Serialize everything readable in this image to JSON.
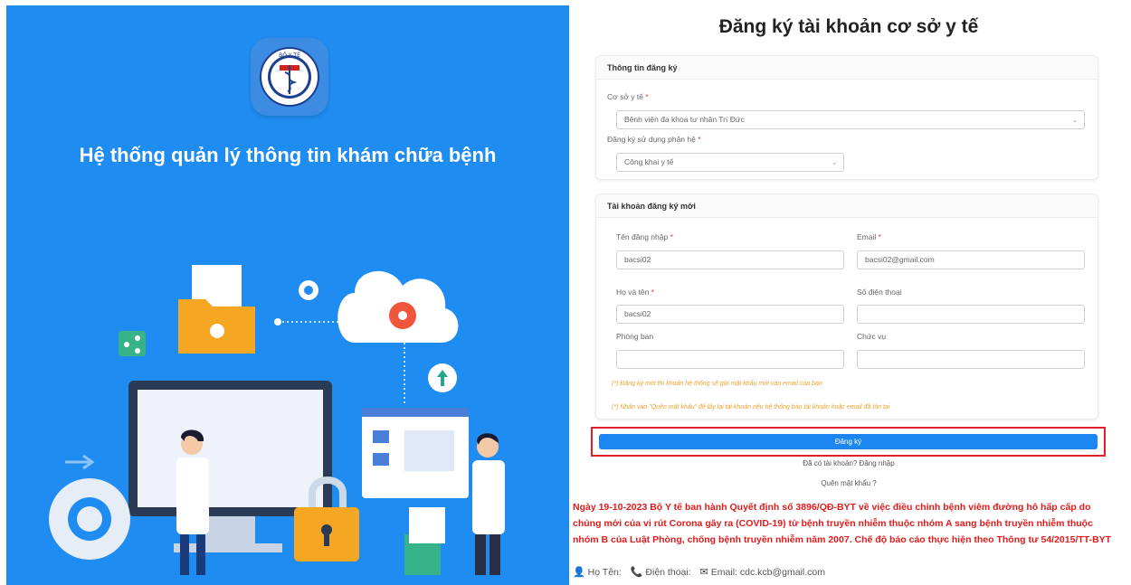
{
  "left_panel": {
    "headline": "Hệ thống quản lý thông tin khám chữa bệnh",
    "logo_icon": "ministry-of-health-seal",
    "logo_text_top": "BỘ Y TẾ",
    "logo_text_bottom": "MINISTRY OF HEALTH",
    "background_color": "#1f8cf1"
  },
  "form": {
    "title": "Đăng ký tài khoản cơ sở y tế",
    "section1": {
      "heading": "Thông tin đăng ký",
      "facility_label": "Cơ sở y tế",
      "facility_value": "Bệnh viện đa khoa tư nhân Trí Đức",
      "module_label": "Đăng ký sử dụng phân hệ",
      "module_value": "Công khai y tế"
    },
    "section2": {
      "heading": "Tài khoản đăng ký mới",
      "username_label": "Tên đăng nhập",
      "username_value": "bacsi02",
      "email_label": "Email",
      "email_value": "bacsi02@gmail.com",
      "fullname_label": "Họ và tên",
      "fullname_value": "bacsi02",
      "phone_label": "Số điện thoại",
      "phone_value": "",
      "department_label": "Phòng ban",
      "department_value": "",
      "position_label": "Chức vụ",
      "position_value": "",
      "note1": "(*) Đăng ký mới thì khoản hệ thống sẽ gửi mật khẩu mới vào email của bạn",
      "note2": "(*) Nhấn vào \"Quên mật khẩu\" để lấy lại tài khoản nếu hệ thống báo tài khoản hoặc email đã tồn tại"
    },
    "submit_label": "Đăng ký",
    "login_link": "Đã có tài khoản? Đăng nhập",
    "forgot_link": "Quên mật khẩu ?",
    "required_mark": "*"
  },
  "announcement": "Ngày 19-10-2023 Bộ Y tế ban hành Quyết định số 3896/QĐ-BYT về việc điều chỉnh bệnh viêm đường hô hấp cấp do chủng mới của vi rút Corona gây ra (COVID-19) từ bệnh truyền nhiễm thuộc nhóm A sang bệnh truyền nhiễm thuộc nhóm B của Luật Phòng, chống bệnh truyền nhiễm năm 2007. Chế độ báo cáo thực hiện theo Thông tư 54/2015/TT-BYT",
  "contact": {
    "name_label": "Họ Tên:",
    "phone_label": "Điện thoại:",
    "email_label": "Email: cdc.kcb@gmail.com"
  },
  "colors": {
    "accent": "#1c86f0",
    "highlight_border": "#e0202a",
    "announcement": "#e11b1b",
    "note": "#f0a030"
  }
}
